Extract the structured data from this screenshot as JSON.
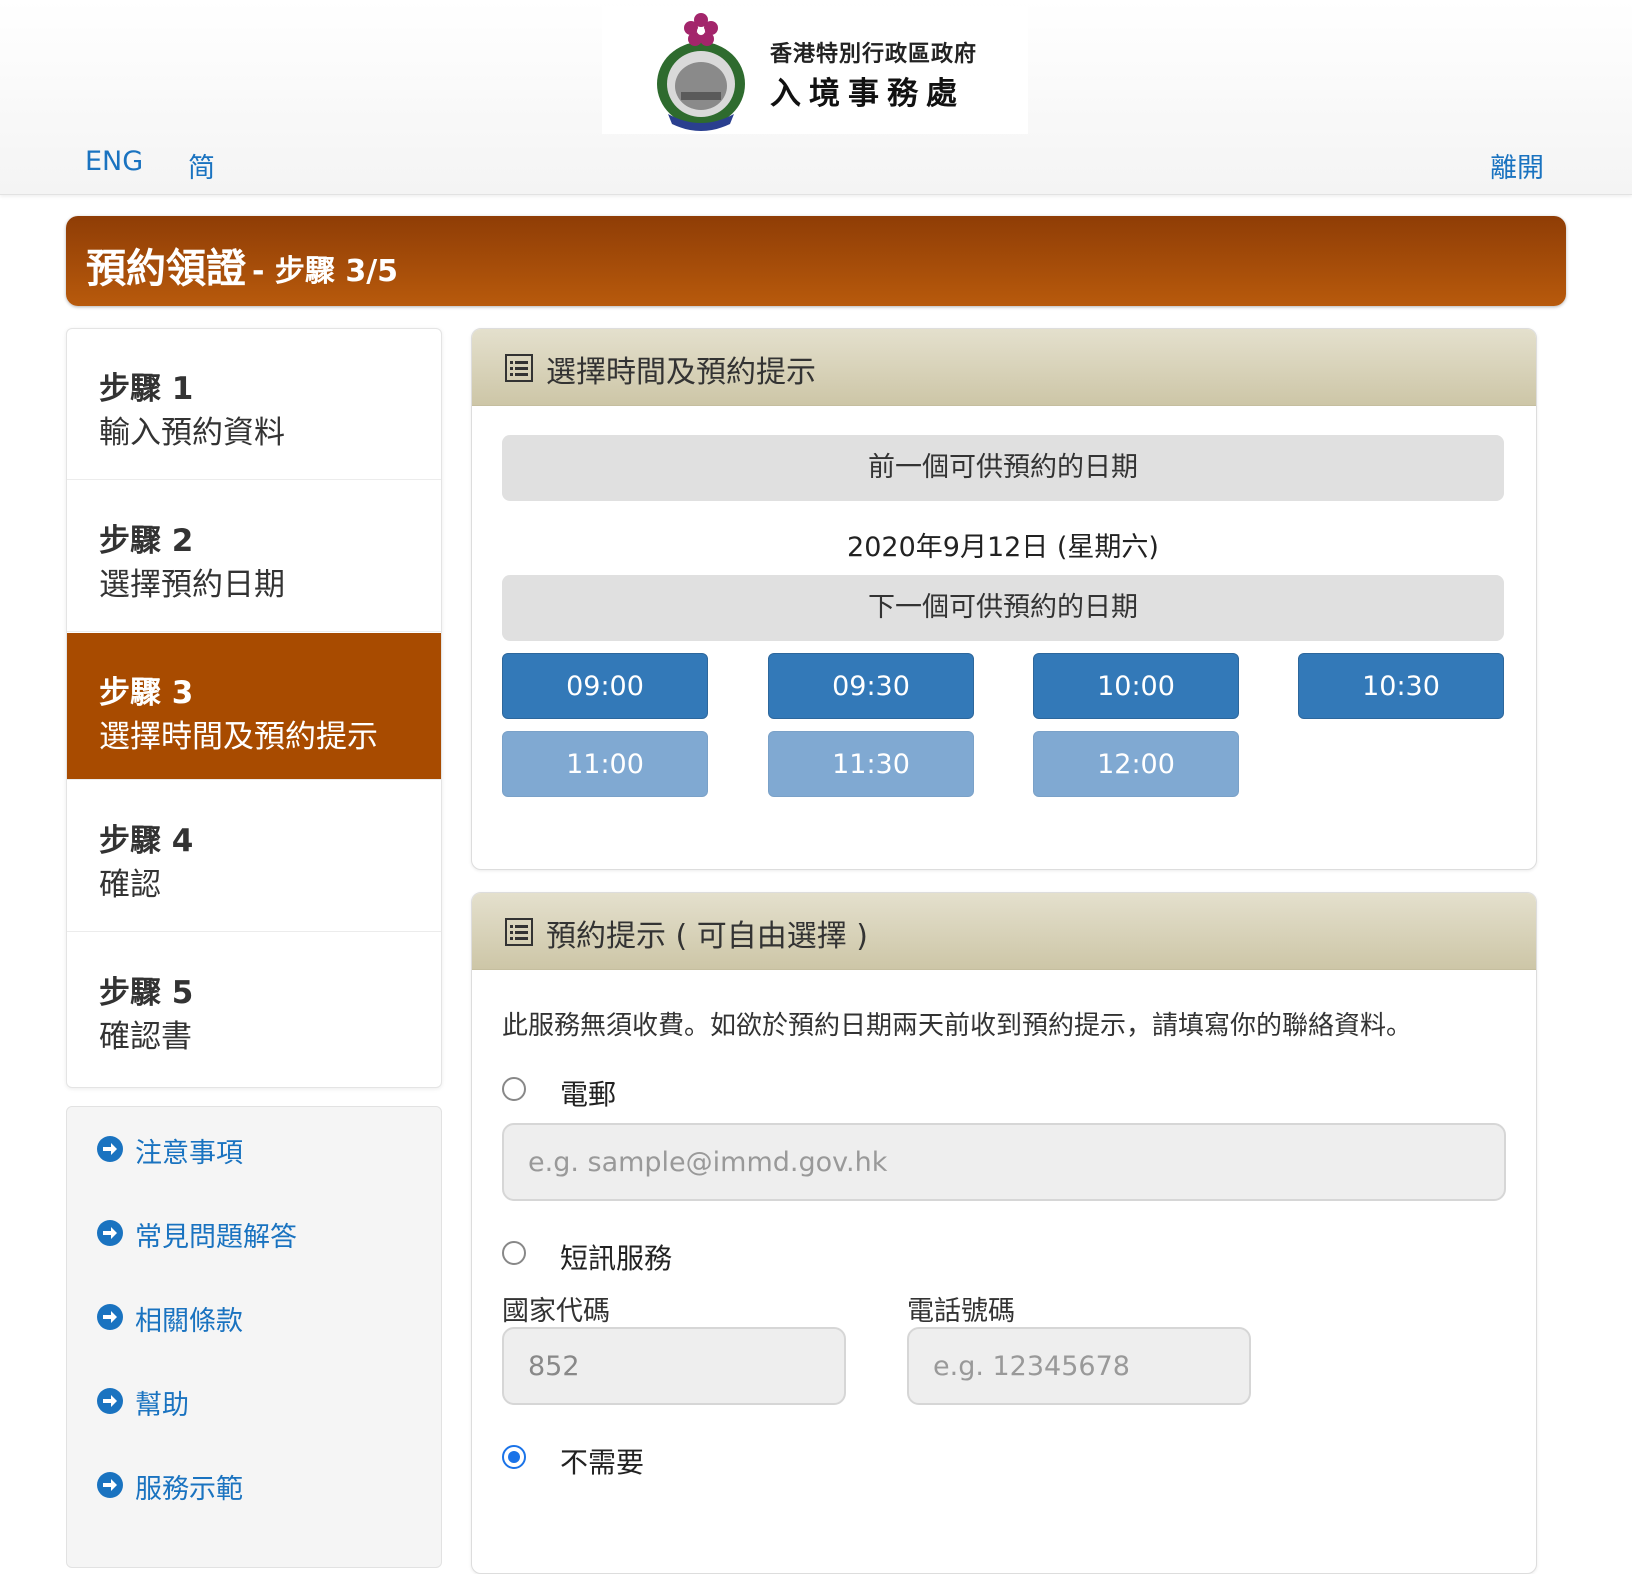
{
  "header": {
    "logo_line1": "香港特別行政區政府",
    "logo_line2": "入境事務處",
    "lang_eng": "ENG",
    "lang_simplified": "简",
    "exit": "離開"
  },
  "banner": {
    "title": "預約領證",
    "step": "- 步驟 3/5"
  },
  "steps": [
    {
      "num": "步驟 1",
      "label": "輸入預約資料"
    },
    {
      "num": "步驟 2",
      "label": "選擇預約日期"
    },
    {
      "num": "步驟 3",
      "label": "選擇時間及預約提示"
    },
    {
      "num": "步驟 4",
      "label": "確認"
    },
    {
      "num": "步驟 5",
      "label": "確認書"
    }
  ],
  "links": [
    {
      "label": "注意事項"
    },
    {
      "label": "常見問題解答"
    },
    {
      "label": "相關條款"
    },
    {
      "label": "幫助"
    },
    {
      "label": "服務示範"
    }
  ],
  "time_panel": {
    "title": "選擇時間及預約提示",
    "prev_date": "前一個可供預約的日期",
    "date": "2020年9月12日 (星期六)",
    "next_date": "下一個可供預約的日期",
    "slots_available": [
      "09:00",
      "09:30",
      "10:00",
      "10:30"
    ],
    "slots_unavailable": [
      "11:00",
      "11:30",
      "12:00"
    ]
  },
  "reminder_panel": {
    "title": "預約提示 ( 可自由選擇 )",
    "description": "此服務無須收費。如欲於預約日期兩天前收到預約提示，請填寫你的聯絡資料。",
    "email_label": "電郵",
    "email_placeholder": "e.g. sample@immd.gov.hk",
    "sms_label": "短訊服務",
    "country_code_label": "國家代碼",
    "country_code_value": "852",
    "phone_label": "電話號碼",
    "phone_placeholder": "e.g. 12345678",
    "none_label": "不需要"
  },
  "colors": {
    "accent_brown": "#a84b00",
    "link_blue": "#1a73c0",
    "slot_blue": "#3379b8",
    "slot_disabled": "#80a9d2"
  }
}
